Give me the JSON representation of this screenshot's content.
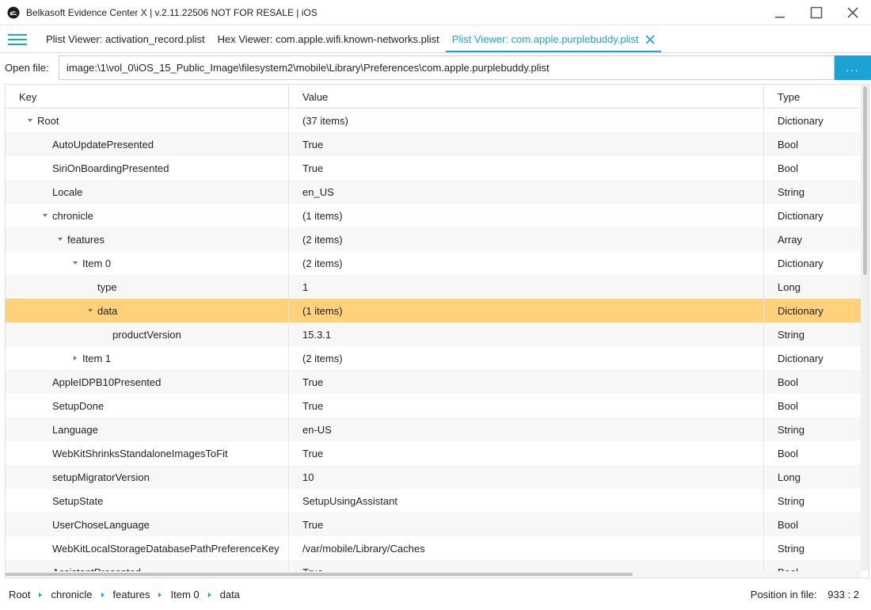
{
  "window": {
    "title": "Belkasoft Evidence Center X | v.2.11.22506 NOT FOR RESALE | iOS"
  },
  "tabs": [
    {
      "label": "Plist Viewer: activation_record.plist",
      "active": false
    },
    {
      "label": "Hex Viewer: com.apple.wifi.known-networks.plist",
      "active": false
    },
    {
      "label": "Plist Viewer: com.apple.purplebuddy.plist",
      "active": true
    }
  ],
  "open_file": {
    "label": "Open file:",
    "value": "image:\\1\\vol_0\\iOS_15_Public_Image\\filesystem2\\mobile\\Library\\Preferences\\com.apple.purplebuddy.plist",
    "browse_label": "..."
  },
  "grid": {
    "columns": {
      "key": "Key",
      "value": "Value",
      "type": "Type"
    },
    "rows": [
      {
        "key": "Root",
        "value": "(37 items)",
        "type": "Dictionary",
        "level": 0,
        "expander": "down"
      },
      {
        "key": "AutoUpdatePresented",
        "value": "True",
        "type": "Bool",
        "level": 1,
        "expander": "none"
      },
      {
        "key": "SiriOnBoardingPresented",
        "value": "True",
        "type": "Bool",
        "level": 1,
        "expander": "none"
      },
      {
        "key": "Locale",
        "value": "en_US",
        "type": "String",
        "level": 1,
        "expander": "none"
      },
      {
        "key": "chronicle",
        "value": "(1 items)",
        "type": "Dictionary",
        "level": 1,
        "expander": "down"
      },
      {
        "key": "features",
        "value": "(2 items)",
        "type": "Array",
        "level": 2,
        "expander": "down"
      },
      {
        "key": "Item 0",
        "value": "(2 items)",
        "type": "Dictionary",
        "level": 3,
        "expander": "down"
      },
      {
        "key": "type",
        "value": "1",
        "type": "Long",
        "level": 4,
        "expander": "none"
      },
      {
        "key": "data",
        "value": "(1 items)",
        "type": "Dictionary",
        "level": 4,
        "expander": "down",
        "selected": true
      },
      {
        "key": "productVersion",
        "value": "15.3.1",
        "type": "String",
        "level": 5,
        "expander": "none"
      },
      {
        "key": "Item 1",
        "value": "(2 items)",
        "type": "Dictionary",
        "level": 3,
        "expander": "right"
      },
      {
        "key": "AppleIDPB10Presented",
        "value": "True",
        "type": "Bool",
        "level": 1,
        "expander": "none"
      },
      {
        "key": "SetupDone",
        "value": "True",
        "type": "Bool",
        "level": 1,
        "expander": "none"
      },
      {
        "key": "Language",
        "value": "en-US",
        "type": "String",
        "level": 1,
        "expander": "none"
      },
      {
        "key": "WebKitShrinksStandaloneImagesToFit",
        "value": "True",
        "type": "Bool",
        "level": 1,
        "expander": "none"
      },
      {
        "key": "setupMigratorVersion",
        "value": "10",
        "type": "Long",
        "level": 1,
        "expander": "none"
      },
      {
        "key": "SetupState",
        "value": "SetupUsingAssistant",
        "type": "String",
        "level": 1,
        "expander": "none"
      },
      {
        "key": "UserChoseLanguage",
        "value": "True",
        "type": "Bool",
        "level": 1,
        "expander": "none"
      },
      {
        "key": "WebKitLocalStorageDatabasePathPreferenceKey",
        "value": "/var/mobile/Library/Caches",
        "type": "String",
        "level": 1,
        "expander": "none"
      },
      {
        "key": "AssistantPresented",
        "value": "True",
        "type": "Bool",
        "level": 1,
        "expander": "none"
      }
    ]
  },
  "breadcrumbs": [
    "Root",
    "chronicle",
    "features",
    "Item 0",
    "data"
  ],
  "status": {
    "position_label": "Position in file:",
    "position_value": "933 : 2"
  },
  "colors": {
    "accent": "#1ba3d6",
    "selection": "#ffd17a"
  },
  "icons": {
    "app": "belkasoft-logo-icon",
    "menu": "hamburger-menu-icon",
    "close_tab": "close-icon",
    "expand": "triangle-down-icon",
    "collapsed": "triangle-right-icon",
    "crumb_separator": "triangle-right-icon"
  }
}
